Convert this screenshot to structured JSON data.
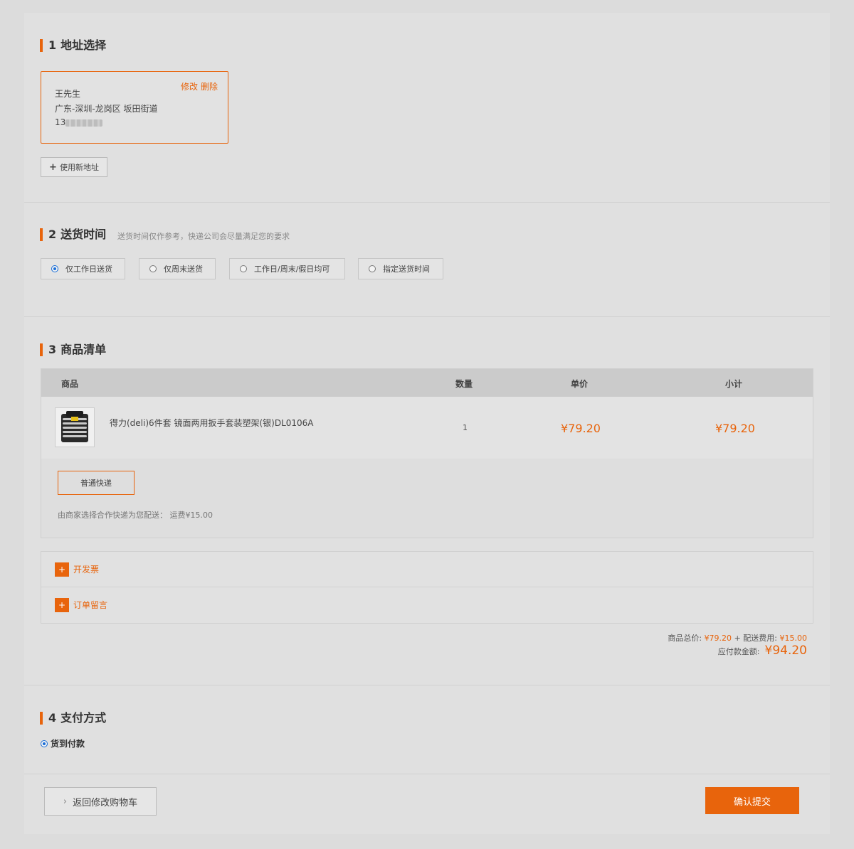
{
  "address": {
    "section_num": "1",
    "title": "地址选择",
    "card": {
      "name": "王先生",
      "location": "广东-深圳-龙岗区 坂田街道",
      "phone_prefix": "13",
      "edit_label": "修改",
      "delete_label": "删除"
    },
    "new_address_label": "使用新地址"
  },
  "delivery": {
    "section_num": "2",
    "title": "送货时间",
    "hint": "送货时间仅作参考，快递公司会尽量满足您的要求",
    "options": [
      {
        "label": "仅工作日送货",
        "selected": true
      },
      {
        "label": "仅周末送货",
        "selected": false
      },
      {
        "label": "工作日/周末/假日均可",
        "selected": false
      },
      {
        "label": "指定送货时间",
        "selected": false
      }
    ]
  },
  "items": {
    "section_num": "3",
    "title": "商品清单",
    "headers": {
      "product": "商品",
      "qty": "数量",
      "unit_price": "单价",
      "subtotal": "小计"
    },
    "rows": [
      {
        "name": "得力(deli)6件套 镜面两用扳手套装塑架(银)DL0106A",
        "qty": "1",
        "unit_price": "¥79.20",
        "subtotal": "¥79.20"
      }
    ],
    "shipping_button": "普通快递",
    "shipping_note": "由商家选择合作快递为您配送：  运费¥15.00"
  },
  "extras": {
    "plus_symbol": "+",
    "invoice_label": "开发票",
    "message_label": "订单留言"
  },
  "totals": {
    "goods_label": "商品总价:",
    "goods_value": "¥79.20",
    "plus": "+",
    "shipping_label": "配送费用:",
    "shipping_value": "¥15.00",
    "payable_label": "应付款金额:",
    "payable_value": "¥94.20"
  },
  "payment": {
    "section_num": "4",
    "title": "支付方式",
    "option": "货到付款"
  },
  "footer": {
    "back_label": "返回修改购物车",
    "submit_label": "确认提交"
  },
  "colors": {
    "accent": "#e8640c",
    "radio_selected": "#1a6ed8",
    "background": "#e0e0e0"
  }
}
